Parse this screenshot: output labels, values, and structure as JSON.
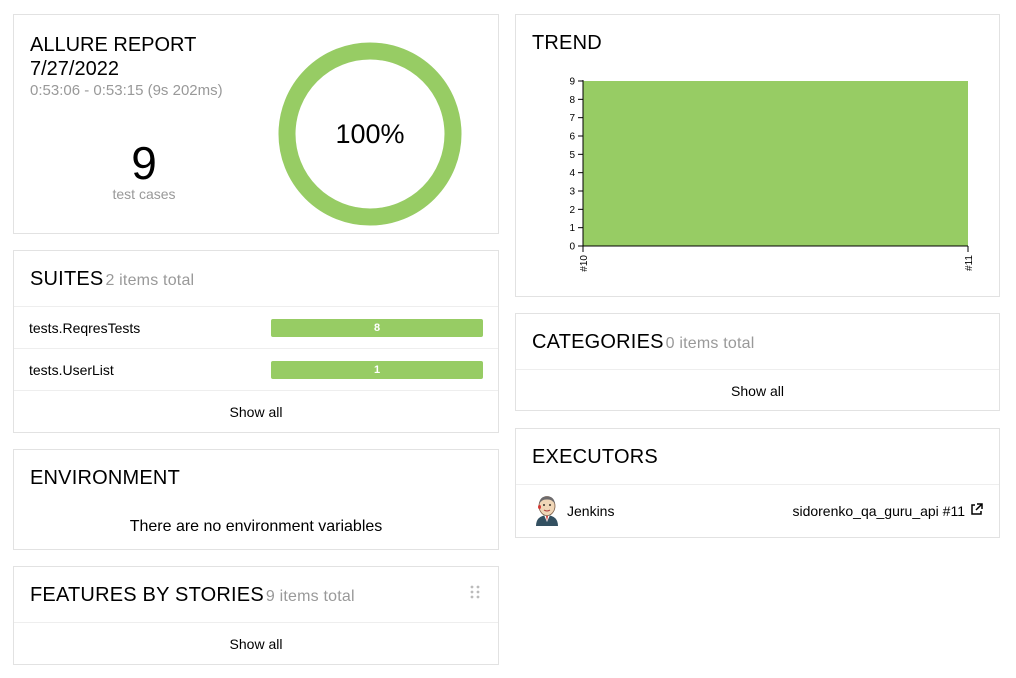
{
  "summary": {
    "title": "ALLURE REPORT",
    "date": "7/27/2022",
    "time_range": "0:53:06 - 0:53:15 (9s 202ms)",
    "test_count": "9",
    "test_count_label": "test cases",
    "percent": "100%",
    "pass_rate": 1.0,
    "ring_color": "#97cc64"
  },
  "suites": {
    "title": "SUITES",
    "subtitle": "2 items total",
    "items": [
      {
        "name": "tests.ReqresTests",
        "count": "8"
      },
      {
        "name": "tests.UserList",
        "count": "1"
      }
    ],
    "show_all": "Show all"
  },
  "environment": {
    "title": "ENVIRONMENT",
    "message": "There are no environment variables"
  },
  "features": {
    "title": "FEATURES BY STORIES",
    "subtitle": "9 items total",
    "show_all": "Show all",
    "drag_icon": "drag-handle-icon"
  },
  "trend": {
    "title": "TREND"
  },
  "chart_data": {
    "type": "area",
    "x": [
      "#10",
      "#11"
    ],
    "series": [
      {
        "values": [
          9,
          9
        ],
        "color": "#97cc64"
      }
    ],
    "y_ticks": [
      "0",
      "1",
      "2",
      "3",
      "4",
      "5",
      "6",
      "7",
      "8",
      "9"
    ],
    "ylim": [
      0,
      9
    ]
  },
  "categories": {
    "title": "CATEGORIES",
    "subtitle": "0 items total",
    "show_all": "Show all"
  },
  "executors": {
    "title": "EXECUTORS",
    "name": "Jenkins",
    "build": "sidorenko_qa_guru_api #11",
    "avatar_icon": "jenkins-avatar-icon",
    "link_icon": "external-link-icon"
  }
}
